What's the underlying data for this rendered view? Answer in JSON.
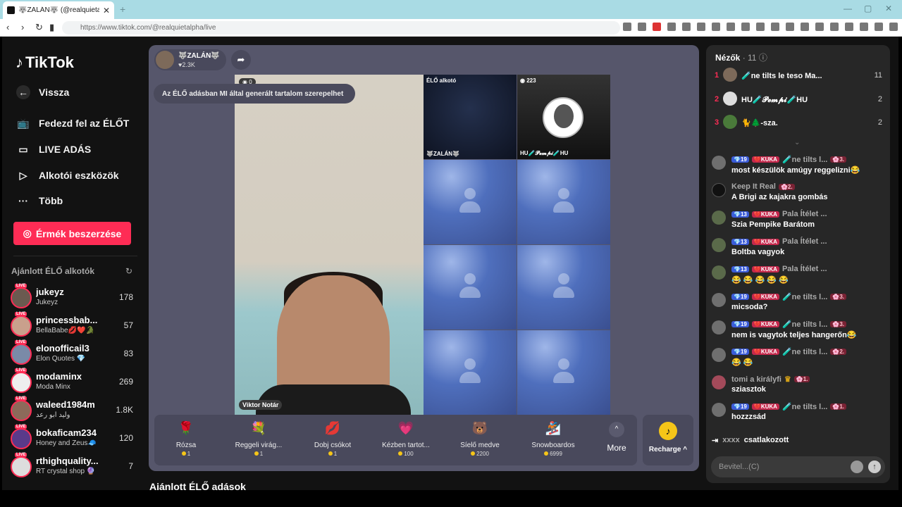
{
  "browser": {
    "tab_title": "🐺ZALÁN🐺 (@realquietalpha",
    "url": "https://www.tiktok.com/@realquietalpha/live",
    "new_tab": "+",
    "close": "✕"
  },
  "sidebar": {
    "logo": "TikTok",
    "back": "Vissza",
    "items": [
      {
        "label": "Fedezd fel az ÉLŐT",
        "icon": "tv-icon"
      },
      {
        "label": "LIVE ADÁS",
        "icon": "camera-icon"
      },
      {
        "label": "Alkotói eszközök",
        "icon": "tools-icon"
      },
      {
        "label": "Több",
        "icon": "more-icon"
      }
    ],
    "coins_button": "Érmék beszerzése",
    "recommended_title": "Ajánlott ÉLŐ alkotók",
    "live_badge": "LIVE",
    "creators": [
      {
        "name": "jukeyz",
        "desc": "Jukeyz",
        "count": "178"
      },
      {
        "name": "princessbab...",
        "desc": "BellaBabe💋❤️🐊",
        "count": "57"
      },
      {
        "name": "elonofficail3",
        "desc": "Elon Quotes 💎",
        "count": "83"
      },
      {
        "name": "modaminx",
        "desc": "Moda Minx",
        "count": "269"
      },
      {
        "name": "waleed1984m",
        "desc": "وليد ابو رعد",
        "count": "1.8K"
      },
      {
        "name": "bokaficam234",
        "desc": "Honey and Zeus🧢",
        "count": "120"
      },
      {
        "name": "rthighquality...",
        "desc": "RT crystal shop 🔮",
        "count": "7"
      }
    ]
  },
  "stream": {
    "host_name": "🐺ZALÁN🐺",
    "host_likes": "♥2.3K",
    "ai_notice": "Az ÉLŐ adásban MI által generált tartalom szerepelhet",
    "main_viewers": "0",
    "main_guest": "Viktor Notár",
    "cell_tag": "ÉLŐ alkotó",
    "cell_host": "🐺ZALÁN🐺",
    "pempi_count": "223",
    "pempi_name": "HU🧪𝓟𝓮𝓶𝓹𝓲🧪HU"
  },
  "gifts": [
    {
      "name": "Rózsa",
      "price": "1",
      "icon": "🌹"
    },
    {
      "name": "Reggeli virág...",
      "price": "1",
      "icon": "💐"
    },
    {
      "name": "Dobj csókot",
      "price": "1",
      "icon": "💋"
    },
    {
      "name": "Kézben tartot...",
      "price": "100",
      "icon": "💗"
    },
    {
      "name": "Síelő medve",
      "price": "2200",
      "icon": "🐻"
    },
    {
      "name": "Snowboardos",
      "price": "6999",
      "icon": "🏂"
    }
  ],
  "more_label": "More",
  "recharge_label": "Recharge ^",
  "below_title": "Ajánlott ÉLŐ adások",
  "chat": {
    "viewers_label": "Nézők",
    "viewers_count": "· 11",
    "top_viewers": [
      {
        "rank": "1",
        "name": "🧪ne tilts le teso Ma...",
        "score": "11"
      },
      {
        "rank": "2",
        "name": "HU🧪𝓟𝓮𝓶𝓹𝓲🧪HU",
        "score": "2"
      },
      {
        "rank": "3",
        "name": "🐈🌲-sza.",
        "score": "2"
      }
    ],
    "messages": [
      {
        "b1": "💎19",
        "b2": "💔KUKA",
        "user": "🧪ne tilts l...",
        "b3": "🌸3.",
        "text": "most készülök amúgy reggelizni😂"
      },
      {
        "b1": "",
        "b2": "",
        "user": "Keep It Real",
        "b3": "🌸2.",
        "text": "A Brigi az kajakra gombás"
      },
      {
        "b1": "💎13",
        "b2": "💔KUKA",
        "user": "Pala Ítélet ...",
        "b3": "",
        "text": "Szia Pempike Barátom"
      },
      {
        "b1": "💎13",
        "b2": "💔KUKA",
        "user": "Pala Ítélet ...",
        "b3": "",
        "text": "Boltba vagyok"
      },
      {
        "b1": "💎13",
        "b2": "💔KUKA",
        "user": "Pala Ítélet ...",
        "b3": "",
        "text": "😂 😂 😂 😂 😂"
      },
      {
        "b1": "💎19",
        "b2": "💔KUKA",
        "user": "🧪ne tilts l...",
        "b3": "🌸3.",
        "text": "micsoda?"
      },
      {
        "b1": "💎19",
        "b2": "💔KUKA",
        "user": "🧪ne tilts l...",
        "b3": "🌸3.",
        "text": "nem is vagytok teljes hangerőn😂"
      },
      {
        "b1": "💎19",
        "b2": "💔KUKA",
        "user": "🧪ne tilts l...",
        "b3": "🌸2.",
        "text": "😂 😂"
      },
      {
        "b1": "",
        "b2": "",
        "user": "tomi a királyfi",
        "b3": "🌸1.",
        "text": "sziasztok"
      },
      {
        "b1": "💎19",
        "b2": "💔KUKA",
        "user": "🧪ne tilts l...",
        "b3": "🌸1.",
        "text": "hozzzsád"
      }
    ],
    "joined_name": "xxxx",
    "joined_text": "csatlakozott",
    "input_placeholder": "Bevitel...(C)"
  }
}
